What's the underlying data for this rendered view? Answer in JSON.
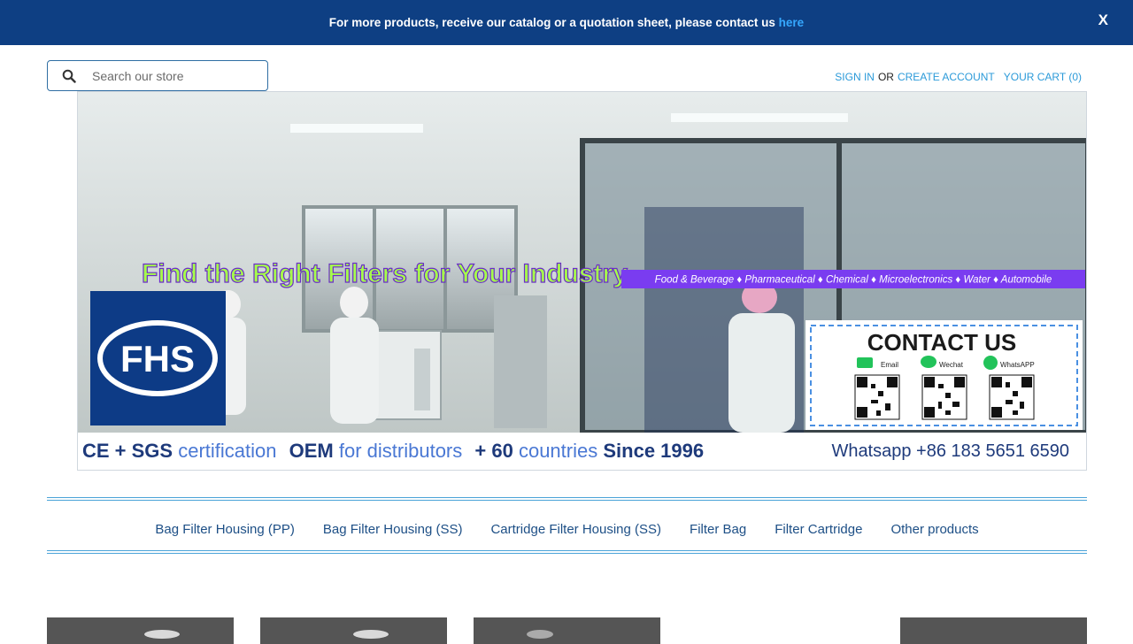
{
  "announcement": {
    "text": "For more products, receive our catalog or a quotation sheet, please contact us ",
    "link_label": "here",
    "close_label": "X"
  },
  "search": {
    "placeholder": "Search our store"
  },
  "account": {
    "sign_in": "SIGN IN",
    "or": "OR",
    "create_account": "CREATE ACCOUNT",
    "cart": "YOUR CART (0)"
  },
  "hero": {
    "headline": "Find the Right Filters for Your Industry.",
    "industries": "Food & Beverage ♦ Pharmaceutical ♦ Chemical ♦ Microelectronics ♦ Water ♦ Automobile",
    "logo": "FHS",
    "contact_title": "CONTACT US",
    "contact_channels": [
      "Email",
      "Wechat",
      "WhatsAPP"
    ],
    "footer": {
      "cert_bold": "CE + SGS",
      "cert_light": "certification",
      "oem_bold": "OEM",
      "oem_light": "for distributors",
      "countries_bold": "+ 60",
      "countries_light": "countries",
      "since": "Since 1996",
      "whatsapp": "Whatsapp +86 183 5651 6590"
    }
  },
  "nav": {
    "items": [
      "Bag Filter Housing (PP)",
      "Bag Filter Housing (SS)",
      "Cartridge Filter Housing (SS)",
      "Filter Bag",
      "Filter Cartridge",
      "Other products"
    ]
  },
  "colors": {
    "announcement_bg": "#0e3f83",
    "link_accent": "#2b9ad9",
    "nav_text": "#1d4f86",
    "headline_green": "#a6ff4a",
    "banner_purple": "#7a3cf0"
  }
}
